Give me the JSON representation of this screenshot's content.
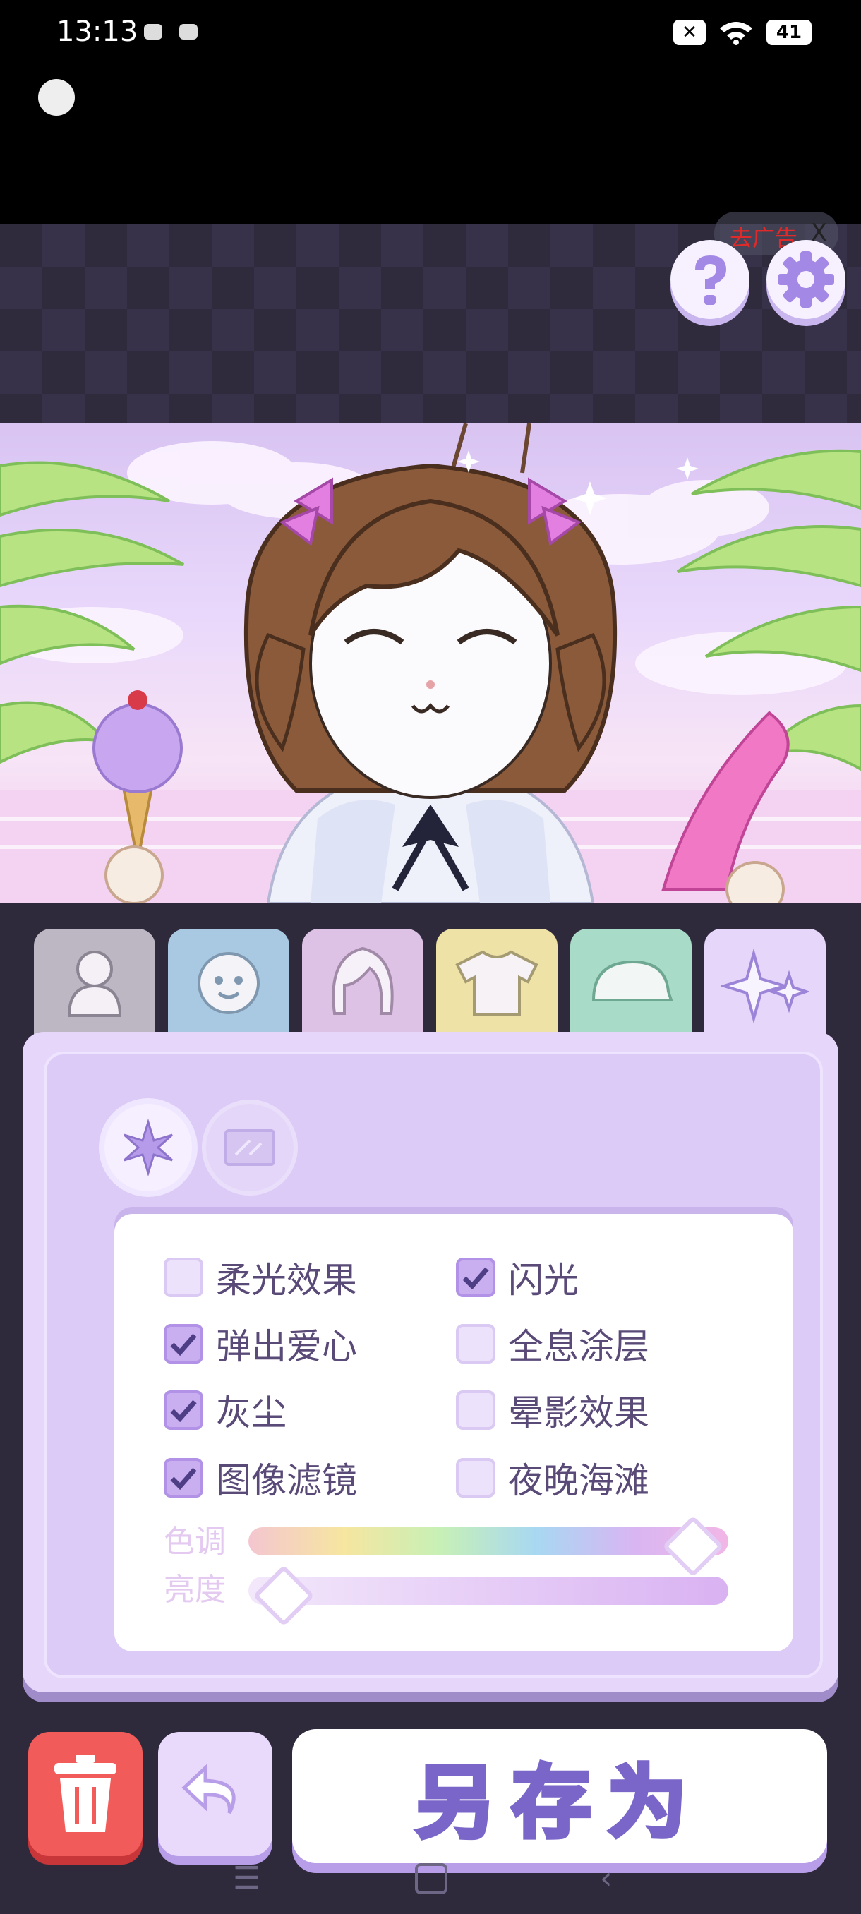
{
  "status_bar": {
    "time": "13:13",
    "battery": "41"
  },
  "ad_badge": {
    "label": "去广告",
    "close": "X"
  },
  "top_buttons": {
    "help_icon": "question-mark",
    "settings_icon": "gear"
  },
  "tabs": [
    {
      "icon": "body-icon",
      "color": "#bdb7c4"
    },
    {
      "icon": "face-icon",
      "color": "#a9c9e2"
    },
    {
      "icon": "hair-icon",
      "color": "#dec2e5"
    },
    {
      "icon": "shirt-icon",
      "color": "#efe2a6"
    },
    {
      "icon": "hat-icon",
      "color": "#a9dcc8"
    },
    {
      "icon": "sparkle-icon",
      "color": "#e6d6fa",
      "active": true
    }
  ],
  "effects": {
    "options": [
      {
        "label": "柔光效果",
        "checked": false
      },
      {
        "label": "闪光",
        "checked": true
      },
      {
        "label": "弹出爱心",
        "checked": true
      },
      {
        "label": "全息涂层",
        "checked": false
      },
      {
        "label": "灰尘",
        "checked": true
      },
      {
        "label": "晕影效果",
        "checked": false
      },
      {
        "label": "图像滤镜",
        "checked": true
      },
      {
        "label": "夜晚海滩",
        "checked": false
      }
    ],
    "hue_label": "色调",
    "brightness_label": "亮度",
    "hue_value": 0.95,
    "brightness_value": 0.03
  },
  "bottom": {
    "save_label": "另存为"
  }
}
